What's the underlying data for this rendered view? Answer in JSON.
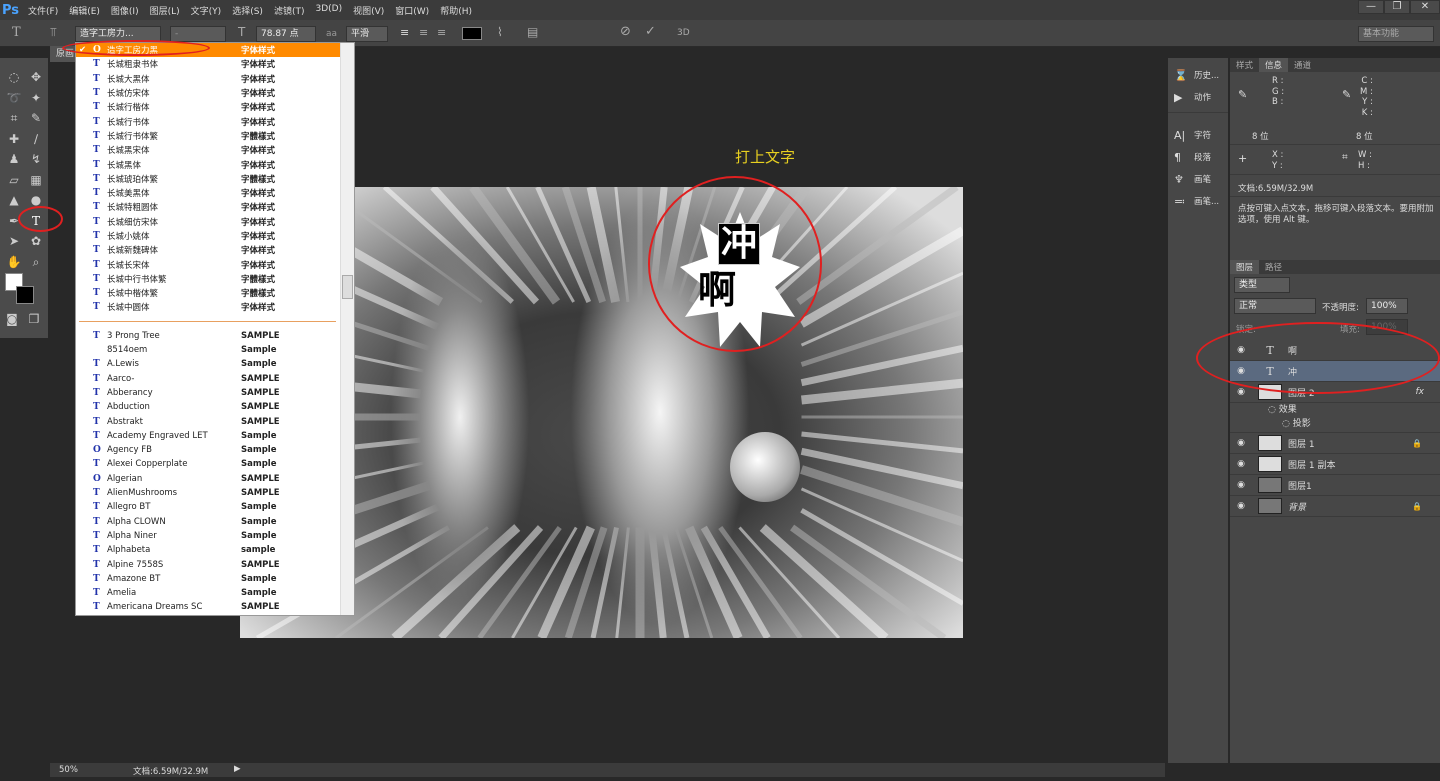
{
  "app": {
    "logo": "Ps",
    "menu": [
      "文件(F)",
      "编辑(E)",
      "图像(I)",
      "图层(L)",
      "文字(Y)",
      "选择(S)",
      "滤镜(T)",
      "3D(D)",
      "视图(V)",
      "窗口(W)",
      "帮助(H)"
    ],
    "window_buttons": [
      "—",
      "❐",
      "✕"
    ]
  },
  "options": {
    "font_family": "造字工房力...",
    "font_style": "-",
    "font_size": "78.87 点",
    "aa_label": "aa",
    "antialias": "平滑",
    "color": "#000000",
    "threed": "3D",
    "workspace": "基本功能"
  },
  "document": {
    "tab": "原画",
    "annotation": "打上文字",
    "text_layers": [
      "冲",
      "啊"
    ]
  },
  "font_list": {
    "selected": {
      "name": "造字工房力黑",
      "sample": "字体样式"
    },
    "chinese": [
      {
        "name": "长城粗隶书体",
        "sample": "字体样式"
      },
      {
        "name": "长城大黑体",
        "sample": "字体样式"
      },
      {
        "name": "长城仿宋体",
        "sample": "字体样式"
      },
      {
        "name": "长城行楷体",
        "sample": "字体样式"
      },
      {
        "name": "长城行书体",
        "sample": "字体样式"
      },
      {
        "name": "长城行书体繁",
        "sample": "字體樣式"
      },
      {
        "name": "长城黑宋体",
        "sample": "字体样式"
      },
      {
        "name": "长城黑体",
        "sample": "字体样式"
      },
      {
        "name": "长城琥珀体繁",
        "sample": "字體樣式"
      },
      {
        "name": "长城美黑体",
        "sample": "字体样式"
      },
      {
        "name": "长城特粗圆体",
        "sample": "字体样式"
      },
      {
        "name": "长城细仿宋体",
        "sample": "字体样式"
      },
      {
        "name": "长城小姚体",
        "sample": "字体样式"
      },
      {
        "name": "长城新魏碑体",
        "sample": "字体样式"
      },
      {
        "name": "长城长宋体",
        "sample": "字体样式"
      },
      {
        "name": "长城中行书体繁",
        "sample": "字體樣式"
      },
      {
        "name": "长城中楷体繁",
        "sample": "字體樣式"
      },
      {
        "name": "长城中圆体",
        "sample": "字体样式"
      }
    ],
    "latin": [
      {
        "name": "3 Prong Tree",
        "sample": "SAMPLE"
      },
      {
        "name": "8514oem",
        "sample": "Sample",
        "noicon": true
      },
      {
        "name": "A.Lewis",
        "sample": "Sample"
      },
      {
        "name": "Aarco-",
        "sample": "SAMPLE"
      },
      {
        "name": "Abberancy",
        "sample": "SAMPLE"
      },
      {
        "name": "Abduction",
        "sample": "SAMPLE"
      },
      {
        "name": "Abstrakt",
        "sample": "SAMPLE"
      },
      {
        "name": "Academy Engraved LET",
        "sample": "Sample"
      },
      {
        "name": "Agency FB",
        "sample": "Sample",
        "otf": true
      },
      {
        "name": "Alexei Copperplate",
        "sample": "Sample"
      },
      {
        "name": "Algerian",
        "sample": "SAMPLE",
        "otf": true
      },
      {
        "name": "AlienMushrooms",
        "sample": "SAMPLE"
      },
      {
        "name": "Allegro BT",
        "sample": "Sample"
      },
      {
        "name": "Alpha  CLOWN",
        "sample": "Sample"
      },
      {
        "name": "Alpha  Niner",
        "sample": "Sample"
      },
      {
        "name": "Alphabeta",
        "sample": "sample"
      },
      {
        "name": "Alpine 7558S",
        "sample": "SAMPLE"
      },
      {
        "name": "Amazone BT",
        "sample": "Sample"
      },
      {
        "name": "Amelia",
        "sample": "Sample"
      },
      {
        "name": "Americana Dreams SC",
        "sample": "SAMPLE"
      }
    ]
  },
  "narrow_panel": [
    {
      "icon": "history-icon",
      "label": "历史..."
    },
    {
      "icon": "actions-icon",
      "label": "动作"
    },
    {
      "icon": "character-icon",
      "label": "字符"
    },
    {
      "icon": "paragraph-icon",
      "label": "段落"
    },
    {
      "icon": "brush-icon",
      "label": "画笔"
    },
    {
      "icon": "brush-presets-icon",
      "label": "画笔..."
    }
  ],
  "info_panel": {
    "tabs": [
      "样式",
      "信息",
      "通道"
    ],
    "rgb": [
      "R :",
      "G :",
      "B :"
    ],
    "cmyk": [
      "C :",
      "M :",
      "Y :",
      "K :"
    ],
    "bits": "8 位",
    "bits2": "8 位",
    "xy": [
      "X :",
      "Y :"
    ],
    "wh": [
      "W :",
      "H :"
    ],
    "doc": "文档:6.59M/32.9M",
    "hint": "点按可键入点文本，拖移可键入段落文本。要用附加选项，使用 Alt 键。"
  },
  "layers_panel": {
    "tabs": [
      "图层",
      "路径"
    ],
    "filter": "类型",
    "blend": "正常",
    "opacity_label": "不透明度:",
    "opacity": "100%",
    "lock_label": "锁定:",
    "fill_label": "填充:",
    "fill": "100%",
    "layers": [
      {
        "name": "啊",
        "type": "text"
      },
      {
        "name": "冲",
        "type": "text",
        "selected": true
      },
      {
        "name": "图层 2",
        "type": "pixel",
        "fx": "fx"
      },
      {
        "name": "图层 1",
        "type": "pixel",
        "locked": true
      },
      {
        "name": "图层 1 副本",
        "type": "pixel"
      },
      {
        "name": "图层1",
        "type": "pixel"
      },
      {
        "name": "背景",
        "type": "pixel",
        "locked": true
      }
    ],
    "effects_label": "效果",
    "effect": "投影"
  },
  "status": {
    "zoom": "50%",
    "doc": "文档:6.59M/32.9M"
  },
  "colors": {
    "accent": "#ff8a00",
    "annotation": "#e02020",
    "annotation_text": "#e8d020",
    "selected_layer": "#5b6a80"
  }
}
